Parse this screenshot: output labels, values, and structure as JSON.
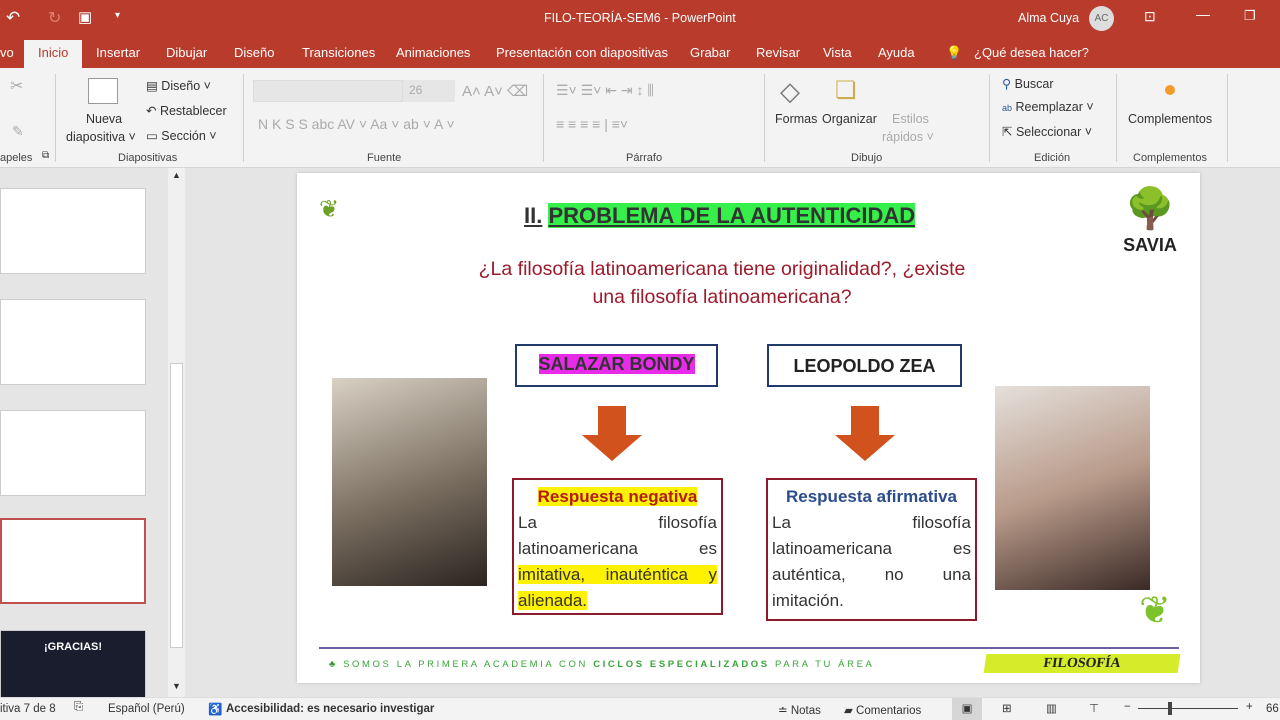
{
  "titlebar": {
    "doc_title": "FILO-TEORÍA-SEM6  -  PowerPoint",
    "user": "Alma Cuya",
    "avatar": "AC"
  },
  "tabs": [
    "vo",
    "Inicio",
    "Insertar",
    "Dibujar",
    "Diseño",
    "Transiciones",
    "Animaciones",
    "Presentación con diapositivas",
    "Grabar",
    "Revisar",
    "Vista",
    "Ayuda"
  ],
  "tell_me": "¿Qué desea hacer?",
  "ribbon": {
    "groups": [
      "apeles",
      "Diapositivas",
      "Fuente",
      "Párrafo",
      "Dibujo",
      "Edición",
      "Complementos"
    ],
    "nueva": "Nueva",
    "diapositiva": "diapositiva ˅",
    "diseno": "Diseño ˅",
    "restablecer": "Restablecer",
    "seccion": "Sección ˅",
    "font_size": "26",
    "font_buttons": "N  K  S  S  abc  AV ˅  Aa ˅  ab ˅  A ˅",
    "formas": "Formas",
    "organizar": "Organizar",
    "estilos": "Estilos",
    "rapidos": "rápidos ˅",
    "buscar": "Buscar",
    "reemplazar": "Reemplazar ˅",
    "seleccionar": "Seleccionar ˅",
    "complementos": "Complementos"
  },
  "slide": {
    "title_prefix": "II.",
    "title": "PROBLEMA DE LA AUTENTICIDAD",
    "question_1": "¿La filosofía latinoamericana tiene originalidad?, ¿existe",
    "question_2": "una filosofía latinoamericana?",
    "left_name": "SALAZAR BONDY",
    "right_name": "LEOPOLDO ZEA",
    "left_head": "Respuesta negativa",
    "left_body": "La filosofía latinoamericana es",
    "left_highlight": "imitativa, inauténtica y alienada.",
    "right_head": "Respuesta afirmativa",
    "right_body": "La filosofía latinoamericana es auténtica, no una imitación.",
    "logo": "SAVIA",
    "footer_a": "SOMOS LA PRIMERA ACADEMIA CON ",
    "footer_b": "CICLOS ESPECIALIZADOS",
    "footer_c": " PARA TU ÁREA",
    "subject": "FILOSOFÍA"
  },
  "thumb_last": "¡GRACIAS!",
  "status": {
    "slide": "itiva 7 de 8",
    "lang": "Español (Perú)",
    "access": "Accesibilidad: es necesario investigar",
    "notes": "Notas",
    "comments": "Comentarios",
    "zoom": "66"
  }
}
